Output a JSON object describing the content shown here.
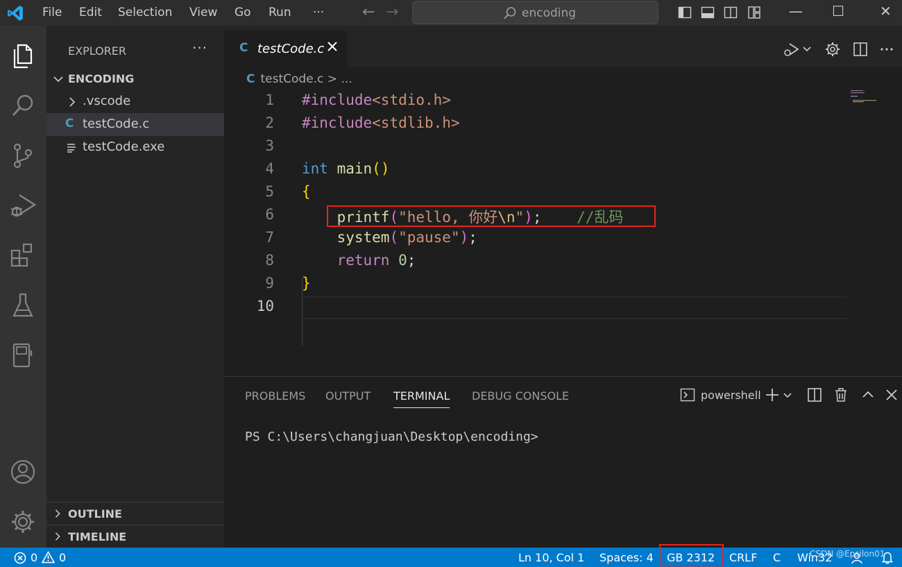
{
  "titlebar": {
    "menu": [
      "File",
      "Edit",
      "Selection",
      "View",
      "Go",
      "Run",
      "···"
    ],
    "search_text": "encoding",
    "minimize": "—",
    "maximize": "☐",
    "close": "✕"
  },
  "sidebar": {
    "title": "EXPLORER",
    "more": "···",
    "root_folder": "ENCODING",
    "items": [
      {
        "label": ".vscode",
        "type": "folder"
      },
      {
        "label": "testCode.c",
        "type": "c-file",
        "icon_text": "C"
      },
      {
        "label": "testCode.exe",
        "type": "file"
      }
    ],
    "outline": "OUTLINE",
    "timeline": "TIMELINE"
  },
  "editor": {
    "tab_label": "testCode.c",
    "tab_icon_text": "C",
    "breadcrumb": "testCode.c > ...",
    "line_numbers": [
      "1",
      "2",
      "3",
      "4",
      "5",
      "6",
      "7",
      "8",
      "9",
      "10"
    ],
    "lines": [
      [
        {
          "t": "#include",
          "c": "kw-p"
        },
        {
          "t": "<stdio.h>",
          "c": "str"
        }
      ],
      [
        {
          "t": "#include",
          "c": "kw-p"
        },
        {
          "t": "<stdlib.h>",
          "c": "str"
        }
      ],
      [],
      [
        {
          "t": "int",
          "c": "kw-b"
        },
        {
          "t": " ",
          "c": "plain"
        },
        {
          "t": "main",
          "c": "fn"
        },
        {
          "t": "()",
          "c": "br1"
        }
      ],
      [
        {
          "t": "{",
          "c": "br1"
        }
      ],
      [
        {
          "t": "    ",
          "c": "plain"
        },
        {
          "t": "printf",
          "c": "fn"
        },
        {
          "t": "(",
          "c": "br2"
        },
        {
          "t": "\"hello, 你好",
          "c": "str"
        },
        {
          "t": "\\n",
          "c": "esc"
        },
        {
          "t": "\"",
          "c": "str"
        },
        {
          "t": ")",
          "c": "br2"
        },
        {
          "t": ";    ",
          "c": "plain"
        },
        {
          "t": "//乱码",
          "c": "cmt"
        }
      ],
      [
        {
          "t": "    ",
          "c": "plain"
        },
        {
          "t": "system",
          "c": "fn"
        },
        {
          "t": "(",
          "c": "br2"
        },
        {
          "t": "\"pause\"",
          "c": "str"
        },
        {
          "t": ")",
          "c": "br2"
        },
        {
          "t": ";",
          "c": "plain"
        }
      ],
      [
        {
          "t": "    ",
          "c": "plain"
        },
        {
          "t": "return",
          "c": "kw-p"
        },
        {
          "t": " ",
          "c": "plain"
        },
        {
          "t": "0",
          "c": "num"
        },
        {
          "t": ";",
          "c": "plain"
        }
      ],
      [
        {
          "t": "}",
          "c": "br1"
        }
      ],
      []
    ]
  },
  "panel": {
    "tabs": [
      "PROBLEMS",
      "OUTPUT",
      "TERMINAL",
      "DEBUG CONSOLE"
    ],
    "active_tab": "TERMINAL",
    "terminal_name": "powershell",
    "terminal_text": "PS C:\\Users\\changjuan\\Desktop\\encoding>"
  },
  "statusbar": {
    "errors": "0",
    "warnings": "0",
    "position": "Ln 10, Col 1",
    "spaces": "Spaces: 4",
    "encoding": "GB 2312",
    "eol": "CRLF",
    "language": "C",
    "platform": "Win32",
    "watermark": "CSDN @Epsilon01"
  },
  "colors": {
    "accent": "#007acc",
    "highlight_box": "#e8231b",
    "c_icon": "#519aba"
  }
}
